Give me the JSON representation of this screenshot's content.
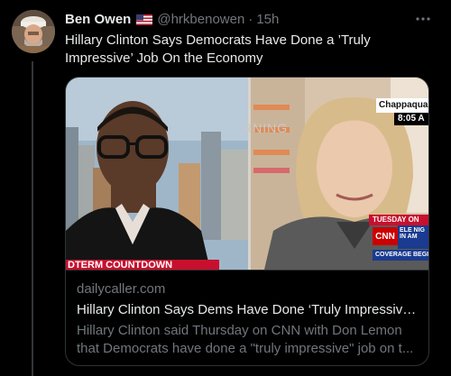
{
  "tweet": {
    "author_name": "Ben Owen",
    "flag_icon": "us-flag-icon",
    "handle": "@hrkbenowen",
    "separator": "·",
    "time": "15h",
    "text": "Hillary Clinton Says Democrats Have Done a ’Truly Impressive’ Job On the Economy"
  },
  "card": {
    "image_overlays": {
      "location": "Chappaqua",
      "clock": "8:05 A",
      "day_banner": "TUESDAY ON",
      "network": "CNN",
      "side_tag": "ELE NIG IN AM",
      "coverage": "COVERAGE BEGINS",
      "lower_third": "DTERM COUNTDOWN",
      "studio_wall": "RNING"
    },
    "domain": "dailycaller.com",
    "title": "Hillary Clinton Says Dems Have Done ‘Truly Impressive’...",
    "description_line1": "Hillary Clinton said Thursday on CNN with Don Lemon",
    "description_line2": "that Democrats have done a \"truly impressive\" job on t..."
  },
  "colors": {
    "background": "#000000",
    "primary_text": "#e7e9ea",
    "secondary_text": "#71767b",
    "border": "#2f3336",
    "cnn_red": "#cc0000"
  },
  "icons": {
    "more": "more-horizontal-icon",
    "avatar": "avatar"
  }
}
